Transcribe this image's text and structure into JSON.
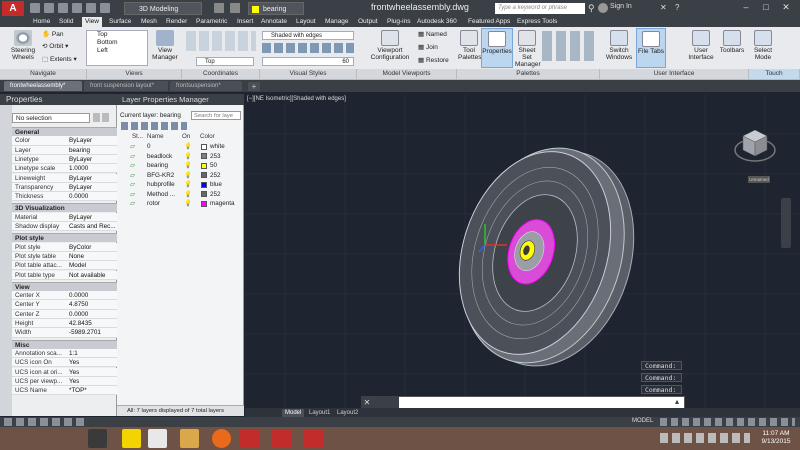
{
  "title_bar": {
    "app_logo": "A",
    "workspace": "3D Modeling",
    "layer": "bearing",
    "document": "frontwheelassembly.dwg",
    "search_placeholder": "Type a keyword or phrase",
    "sign_in": "Sign In"
  },
  "menu_tabs": [
    "Home",
    "Solid",
    "View",
    "Surface",
    "Mesh",
    "Render",
    "Parametric",
    "Insert",
    "Annotate",
    "Layout",
    "Manage",
    "Output",
    "Plug-ins",
    "Autodesk 360",
    "Featured Apps",
    "Express Tools"
  ],
  "active_menu_tab": "View",
  "ribbon": {
    "navigate": {
      "title": "Navigate",
      "steering": "Steering Wheels",
      "pan": "Pan",
      "orbit": "Orbit",
      "extents": "Extents"
    },
    "views": {
      "title": "Views",
      "items": [
        "Top",
        "Bottom",
        "Left"
      ],
      "manager": "View Manager"
    },
    "coordinates": {
      "title": "Coordinates",
      "ucs": "Top"
    },
    "visual_styles": {
      "title": "Visual Styles",
      "style": "Shaded with edges",
      "opacity": "60"
    },
    "model_viewports": {
      "title": "Model Viewports",
      "config": "Viewport Configuration",
      "named": "Named",
      "join": "Join",
      "restore": "Restore"
    },
    "palettes": {
      "title": "Palettes",
      "tool": "Tool Palettes",
      "properties": "Properties",
      "sheet_set": "Sheet Set Manager"
    },
    "user_interface": {
      "title": "User Interface",
      "switch": "Switch Windows",
      "file_tabs": "File Tabs",
      "ui": "User Interface",
      "toolbars": "Toolbars"
    },
    "touch": {
      "title": "Touch",
      "select": "Select Mode"
    }
  },
  "file_tabs": [
    "frontwheelassembly*",
    "front suspension layout*",
    "frontsuspension*"
  ],
  "properties": {
    "title": "Properties",
    "selection": "No selection",
    "sections": [
      {
        "name": "General",
        "rows": [
          [
            "Color",
            "ByLayer"
          ],
          [
            "Layer",
            "bearing"
          ],
          [
            "Linetype",
            "ByLayer"
          ],
          [
            "Linetype scale",
            "1.0000"
          ],
          [
            "Lineweight",
            "ByLayer"
          ],
          [
            "Transparency",
            "ByLayer"
          ],
          [
            "Thickness",
            "0.0000"
          ]
        ]
      },
      {
        "name": "3D Visualization",
        "rows": [
          [
            "Material",
            "ByLayer"
          ],
          [
            "Shadow display",
            "Casts and Rec..."
          ]
        ]
      },
      {
        "name": "Plot style",
        "rows": [
          [
            "Plot style",
            "ByColor"
          ],
          [
            "Plot style table",
            "None"
          ],
          [
            "Plot table attac...",
            "Model"
          ],
          [
            "Plot table type",
            "Not available"
          ]
        ]
      },
      {
        "name": "View",
        "rows": [
          [
            "Center X",
            "0.0000"
          ],
          [
            "Center Y",
            "4.8750"
          ],
          [
            "Center Z",
            "0.0000"
          ],
          [
            "Height",
            "42.8435"
          ],
          [
            "Width",
            "-5989.2701"
          ]
        ]
      },
      {
        "name": "Misc",
        "rows": [
          [
            "Annotation sca...",
            "1:1"
          ],
          [
            "UCS icon On",
            "Yes"
          ],
          [
            "UCS icon at ori...",
            "Yes"
          ],
          [
            "UCS per viewp...",
            "Yes"
          ],
          [
            "UCS Name",
            "*TOP*"
          ]
        ]
      }
    ]
  },
  "layers": {
    "title": "Layer Properties Manager",
    "current": "Current layer: bearing",
    "search_placeholder": "Search for laye",
    "headers": {
      "status": "St...",
      "name": "Name",
      "on": "On",
      "color": "Color"
    },
    "rows": [
      {
        "name": "0",
        "color": "white",
        "hex": "#ffffff"
      },
      {
        "name": "beadlock",
        "color": "253",
        "hex": "#808080"
      },
      {
        "name": "bearing",
        "color": "50",
        "hex": "#ffff00"
      },
      {
        "name": "BFG-KR2",
        "color": "252",
        "hex": "#666666"
      },
      {
        "name": "hubprofile",
        "color": "blue",
        "hex": "#0000ff"
      },
      {
        "name": "Method ...",
        "color": "252",
        "hex": "#666666"
      },
      {
        "name": "rotor",
        "color": "magenta",
        "hex": "#ff00ff"
      }
    ],
    "status": "All: 7 layers displayed of 7 total layers"
  },
  "viewport": {
    "label": "[−][NE Isometric][Shaded with edges]",
    "wcs": "Unnamed",
    "command_history": [
      "Command:",
      "Command:",
      "Command:"
    ]
  },
  "layout_tabs": [
    "Model",
    "Layout1",
    "Layout2"
  ],
  "status": {
    "model": "MODEL"
  },
  "clock": {
    "time": "11:07 AM",
    "date": "9/13/2015"
  }
}
